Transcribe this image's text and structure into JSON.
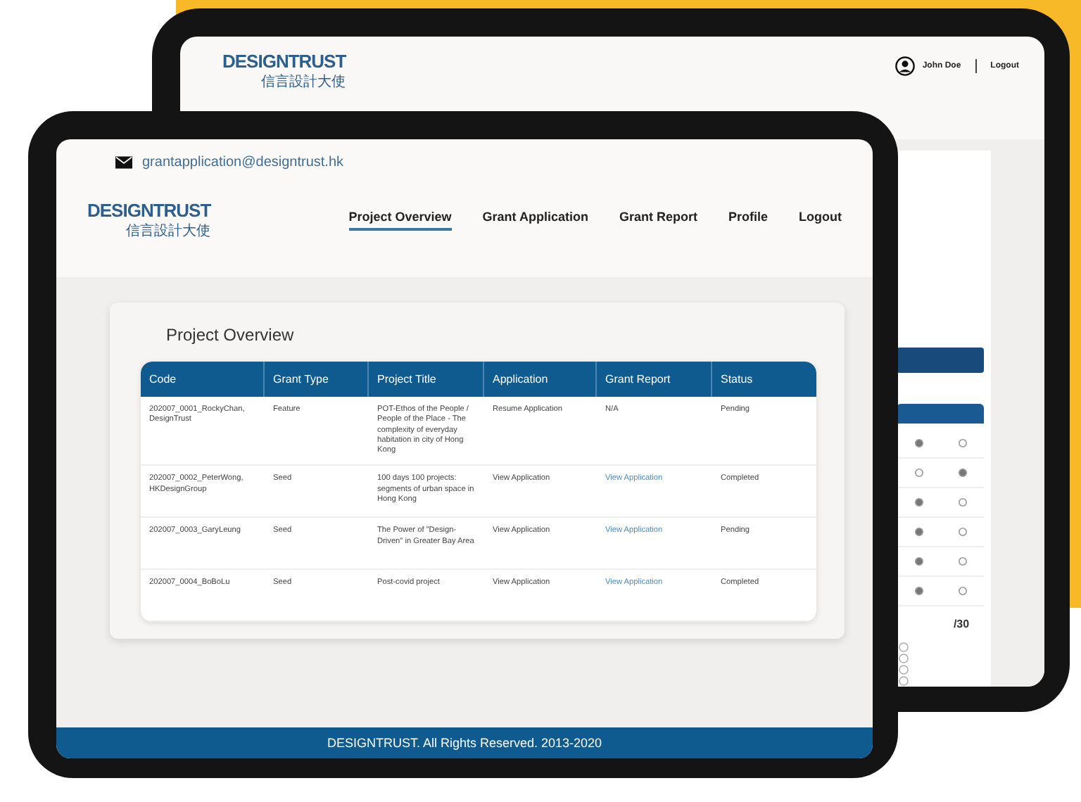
{
  "back_tablet": {
    "logo": {
      "name": "DESIGNTRUST",
      "chinese": "信言設計大使"
    },
    "user": {
      "name": "John Doe",
      "logout": "Logout"
    },
    "side_panel": {
      "total": "/30",
      "rating_rows": [
        {
          "a_selected": true
        },
        {
          "a_selected": false
        },
        {
          "a_selected": true
        },
        {
          "a_selected": true
        },
        {
          "a_selected": true
        },
        {
          "a_selected": true
        }
      ],
      "options": [
        {
          "selected": false
        },
        {
          "selected": false
        },
        {
          "selected": false
        },
        {
          "selected": false
        }
      ]
    }
  },
  "front_tablet": {
    "email": "grantapplication@designtrust.hk",
    "logo": {
      "name": "DESIGNTRUST",
      "chinese": "信言設計大使"
    },
    "nav": [
      {
        "label": "Project Overview",
        "selected": true
      },
      {
        "label": "Grant Application",
        "selected": false
      },
      {
        "label": "Grant Report",
        "selected": false
      },
      {
        "label": "Profile",
        "selected": false
      },
      {
        "label": "Logout",
        "selected": false
      }
    ],
    "page_title": "Project Overview",
    "table": {
      "columns": [
        "Code",
        "Grant Type",
        "Project Title",
        "Application",
        "Grant Report",
        "Status"
      ],
      "rows": [
        {
          "code": "202007_0001_RockyChan, DesignTrust",
          "grant_type": "Feature",
          "project_title": "POT-Ethos of the People / People of the Place - The complexity of everyday habitation in city of Hong Kong",
          "application": "Resume Application",
          "grant_report": "N/A",
          "grant_report_link": false,
          "status": "Pending"
        },
        {
          "code": "202007_0002_PeterWong, HKDesignGroup",
          "grant_type": "Seed",
          "project_title": "100 days 100 projects: segments of urban space in Hong Kong",
          "application": "View Application",
          "grant_report": "View Application",
          "grant_report_link": true,
          "status": "Completed"
        },
        {
          "code": "202007_0003_GaryLeung",
          "grant_type": "Seed",
          "project_title": "The Power of \"Design-Driven\" in Greater Bay Area",
          "application": "View Application",
          "grant_report": "View Application",
          "grant_report_link": true,
          "status": "Pending"
        },
        {
          "code": "202007_0004_BoBoLu",
          "grant_type": "Seed",
          "project_title": "Post-covid project",
          "application": "View Application",
          "grant_report": "View Application",
          "grant_report_link": true,
          "status": "Completed"
        }
      ]
    },
    "footer": "DESIGNTRUST. All Rights Reserved. 2013-2020"
  }
}
